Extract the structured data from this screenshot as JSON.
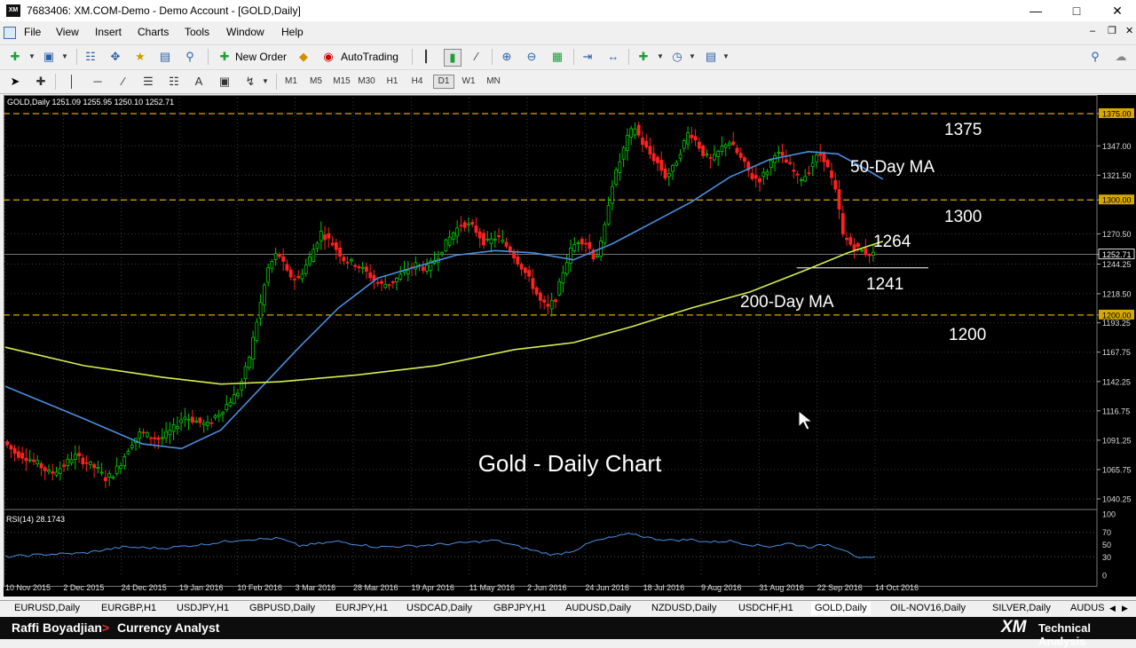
{
  "window": {
    "icon_text": "XM",
    "title": "7683406: XM.COM-Demo - Demo Account - [GOLD,Daily]"
  },
  "menu": [
    "File",
    "View",
    "Insert",
    "Charts",
    "Tools",
    "Window",
    "Help"
  ],
  "toolbar": {
    "new_order": "New Order",
    "autotrading": "AutoTrading"
  },
  "timeframes": [
    "M1",
    "M5",
    "M15",
    "M30",
    "H1",
    "H4",
    "D1",
    "W1",
    "MN"
  ],
  "active_timeframe": "D1",
  "chart": {
    "header": "GOLD,Daily  1251.09 1255.95 1250.10 1252.71",
    "overlay_title": "Gold - Daily Chart",
    "annotations": {
      "r1375": "1375",
      "r1300": "1300",
      "r1200": "1200",
      "r1264": "1264",
      "r1241": "1241",
      "ma50": "50-Day MA",
      "ma200": "200-Day MA"
    },
    "rsi_header": "RSI(14) 28.1743",
    "colors": {
      "bull": "#00c800",
      "bear": "#ff2020",
      "ma50": "#4a8fe0",
      "ma200": "#d4f050",
      "level": "#d8a800"
    }
  },
  "chart_data": {
    "type": "candlestick",
    "symbol": "GOLD",
    "timeframe": "Daily",
    "ylim": [
      1040.25,
      1375.0
    ],
    "price_ticks": [
      "1375.00",
      "1347.00",
      "1321.50",
      "1300.00",
      "1270.50",
      "1252.71",
      "1244.25",
      "1218.50",
      "1200.00",
      "1193.25",
      "1167.75",
      "1142.25",
      "1116.75",
      "1091.25",
      "1065.75",
      "1040.25"
    ],
    "date_ticks": [
      "10 Nov 2015",
      "2 Dec 2015",
      "24 Dec 2015",
      "19 Jan 2016",
      "10 Feb 2016",
      "3 Mar 2016",
      "28 Mar 2016",
      "19 Apr 2016",
      "11 May 2016",
      "2 Jun 2016",
      "24 Jun 2016",
      "18 Jul 2016",
      "9 Aug 2016",
      "31 Aug 2016",
      "22 Sep 2016",
      "14 Oct 2016"
    ],
    "levels": [
      1375,
      1300,
      1200
    ],
    "support_line": 1241,
    "price_path": [
      [
        0,
        1090
      ],
      [
        6,
        1080
      ],
      [
        12,
        1076
      ],
      [
        18,
        1070
      ],
      [
        24,
        1062
      ],
      [
        30,
        1068
      ],
      [
        36,
        1078
      ],
      [
        42,
        1072
      ],
      [
        48,
        1066
      ],
      [
        52,
        1058
      ],
      [
        56,
        1062
      ],
      [
        60,
        1072
      ],
      [
        65,
        1088
      ],
      [
        70,
        1098
      ],
      [
        75,
        1094
      ],
      [
        80,
        1092
      ],
      [
        86,
        1100
      ],
      [
        92,
        1112
      ],
      [
        98,
        1108
      ],
      [
        104,
        1104
      ],
      [
        108,
        1112
      ],
      [
        112,
        1118
      ],
      [
        116,
        1126
      ],
      [
        120,
        1134
      ],
      [
        125,
        1160
      ],
      [
        130,
        1200
      ],
      [
        135,
        1240
      ],
      [
        140,
        1255
      ],
      [
        145,
        1236
      ],
      [
        150,
        1230
      ],
      [
        156,
        1248
      ],
      [
        162,
        1272
      ],
      [
        168,
        1262
      ],
      [
        174,
        1248
      ],
      [
        180,
        1244
      ],
      [
        186,
        1236
      ],
      [
        192,
        1226
      ],
      [
        198,
        1228
      ],
      [
        204,
        1236
      ],
      [
        210,
        1244
      ],
      [
        216,
        1240
      ],
      [
        222,
        1252
      ],
      [
        228,
        1268
      ],
      [
        234,
        1280
      ],
      [
        240,
        1276
      ],
      [
        246,
        1262
      ],
      [
        252,
        1268
      ],
      [
        258,
        1258
      ],
      [
        262,
        1248
      ],
      [
        266,
        1238
      ],
      [
        270,
        1226
      ],
      [
        274,
        1212
      ],
      [
        278,
        1206
      ],
      [
        282,
        1215
      ],
      [
        286,
        1240
      ],
      [
        290,
        1258
      ],
      [
        294,
        1266
      ],
      [
        298,
        1262
      ],
      [
        302,
        1248
      ],
      [
        306,
        1266
      ],
      [
        310,
        1310
      ],
      [
        314,
        1330
      ],
      [
        318,
        1352
      ],
      [
        322,
        1364
      ],
      [
        326,
        1350
      ],
      [
        330,
        1340
      ],
      [
        334,
        1332
      ],
      [
        338,
        1320
      ],
      [
        342,
        1328
      ],
      [
        346,
        1344
      ],
      [
        350,
        1360
      ],
      [
        354,
        1350
      ],
      [
        358,
        1338
      ],
      [
        362,
        1334
      ],
      [
        366,
        1344
      ],
      [
        370,
        1352
      ],
      [
        374,
        1342
      ],
      [
        378,
        1332
      ],
      [
        382,
        1320
      ],
      [
        386,
        1318
      ],
      [
        390,
        1326
      ],
      [
        394,
        1342
      ],
      [
        398,
        1336
      ],
      [
        402,
        1328
      ],
      [
        406,
        1318
      ],
      [
        410,
        1322
      ],
      [
        414,
        1336
      ],
      [
        418,
        1340
      ],
      [
        422,
        1322
      ],
      [
        426,
        1300
      ],
      [
        428,
        1270
      ],
      [
        432,
        1262
      ],
      [
        436,
        1258
      ],
      [
        440,
        1254
      ],
      [
        444,
        1252.71
      ]
    ],
    "series": [
      {
        "name": "50-Day MA",
        "points": [
          [
            0,
            1138
          ],
          [
            40,
            1110
          ],
          [
            70,
            1088
          ],
          [
            90,
            1084
          ],
          [
            110,
            1100
          ],
          [
            130,
            1136
          ],
          [
            150,
            1172
          ],
          [
            170,
            1206
          ],
          [
            190,
            1232
          ],
          [
            210,
            1242
          ],
          [
            230,
            1252
          ],
          [
            250,
            1256
          ],
          [
            270,
            1254
          ],
          [
            290,
            1248
          ],
          [
            310,
            1262
          ],
          [
            330,
            1280
          ],
          [
            350,
            1298
          ],
          [
            370,
            1320
          ],
          [
            390,
            1335
          ],
          [
            410,
            1342
          ],
          [
            425,
            1340
          ],
          [
            440,
            1326
          ],
          [
            448,
            1318
          ]
        ]
      },
      {
        "name": "200-Day MA",
        "points": [
          [
            0,
            1172
          ],
          [
            40,
            1156
          ],
          [
            80,
            1146
          ],
          [
            110,
            1140
          ],
          [
            140,
            1142
          ],
          [
            180,
            1148
          ],
          [
            220,
            1156
          ],
          [
            260,
            1170
          ],
          [
            290,
            1176
          ],
          [
            320,
            1190
          ],
          [
            350,
            1206
          ],
          [
            380,
            1220
          ],
          [
            410,
            1240
          ],
          [
            430,
            1254
          ],
          [
            448,
            1264
          ]
        ]
      }
    ],
    "rsi": {
      "name": "RSI(14)",
      "value": 28.1743,
      "ylim": [
        0,
        100
      ],
      "ticks": [
        100,
        70,
        50,
        30,
        0
      ],
      "points": [
        [
          0,
          30
        ],
        [
          20,
          34
        ],
        [
          40,
          36
        ],
        [
          60,
          46
        ],
        [
          80,
          44
        ],
        [
          100,
          50
        ],
        [
          120,
          58
        ],
        [
          140,
          60
        ],
        [
          150,
          48
        ],
        [
          170,
          55
        ],
        [
          190,
          46
        ],
        [
          210,
          48
        ],
        [
          230,
          52
        ],
        [
          250,
          57
        ],
        [
          270,
          40
        ],
        [
          280,
          33
        ],
        [
          290,
          40
        ],
        [
          300,
          55
        ],
        [
          310,
          62
        ],
        [
          320,
          68
        ],
        [
          330,
          60
        ],
        [
          340,
          57
        ],
        [
          350,
          58
        ],
        [
          360,
          54
        ],
        [
          370,
          56
        ],
        [
          380,
          50
        ],
        [
          390,
          47
        ],
        [
          400,
          52
        ],
        [
          410,
          46
        ],
        [
          420,
          50
        ],
        [
          430,
          40
        ],
        [
          436,
          27
        ],
        [
          444,
          28.17
        ]
      ]
    }
  },
  "symbol_tabs": [
    "EURUSD,Daily",
    "EURGBP,H1",
    "USDJPY,H1",
    "GBPUSD,Daily",
    "EURJPY,H1",
    "USDCAD,Daily",
    "GBPJPY,H1",
    "AUDUSD,Daily",
    "NZDUSD,Daily",
    "USDCHF,H1",
    "GOLD,Daily",
    "OIL-NOV16,Daily",
    "SILVER,Daily",
    "AUDUS"
  ],
  "active_tab": "GOLD,Daily",
  "footer": {
    "presenter": "Raffi Boyadjian",
    "arrow": ">",
    "role": "Currency Analyst",
    "brand": "XM",
    "brand_text": "Technical Analysis"
  }
}
